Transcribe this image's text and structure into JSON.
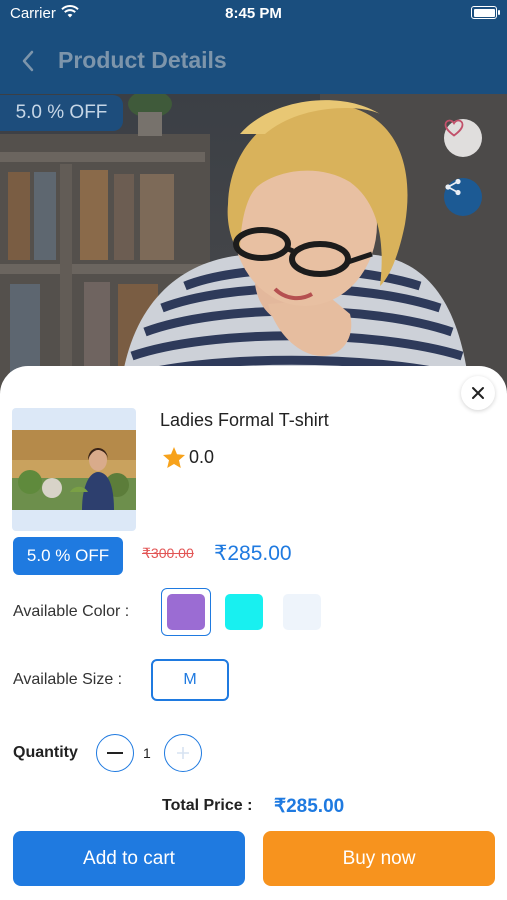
{
  "status_bar": {
    "carrier": "Carrier",
    "time": "8:45 PM"
  },
  "nav": {
    "title": "Product Details"
  },
  "hero": {
    "discount": "5.0 % OFF"
  },
  "product": {
    "name": "Ladies Formal T-shirt",
    "rating": "0.0",
    "discount": "5.0 % OFF",
    "old_price": "₹300.00",
    "new_price": "₹285.00"
  },
  "options": {
    "color_label": "Available Color :",
    "colors": [
      "#9b6cd3",
      "#18f0f0",
      "#eef4fb"
    ],
    "selected_color_index": 0,
    "size_label": "Available  Size :",
    "sizes": [
      "M"
    ],
    "selected_size": "M"
  },
  "quantity": {
    "label": "Quantity",
    "value": "1"
  },
  "total": {
    "label": "Total Price :",
    "value": "₹285.00"
  },
  "actions": {
    "add_to_cart": "Add to cart",
    "buy_now": "Buy now"
  },
  "colors": {
    "primary": "#1f7ae0",
    "accent": "#f7931e",
    "nav_bg": "#1a4e7e"
  }
}
